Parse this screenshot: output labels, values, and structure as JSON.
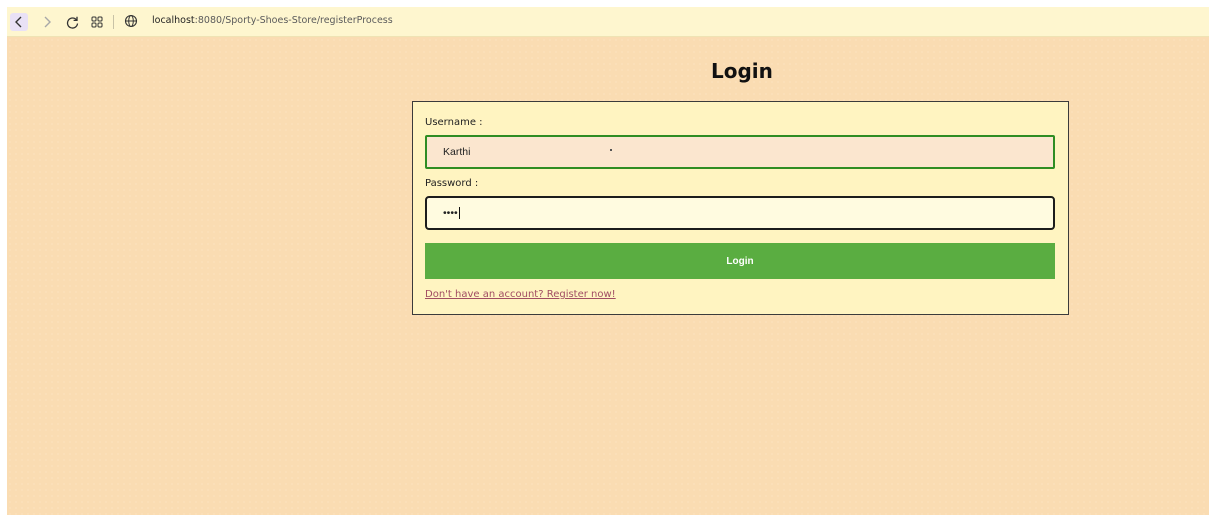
{
  "browser": {
    "url_host": "localhost",
    "url_rest": ":8080/Sporty-Shoes-Store/registerProcess",
    "icons": {
      "back": "chevron-left-icon",
      "forward": "chevron-right-icon",
      "reload": "reload-icon",
      "tabs": "grid-icon",
      "site_info": "globe-icon"
    }
  },
  "page": {
    "title": "Login",
    "username_label": "Username :",
    "username_value": "Karthi",
    "password_label": "Password :",
    "password_masked": "••••",
    "login_button": "Login",
    "register_link": "Don't have an account? Register now!"
  },
  "colors": {
    "page_background": "#fadcb2",
    "form_background": "#fff4c1",
    "login_button": "#5aad41",
    "username_border": "#2f8d23",
    "link": "#a14d63"
  }
}
